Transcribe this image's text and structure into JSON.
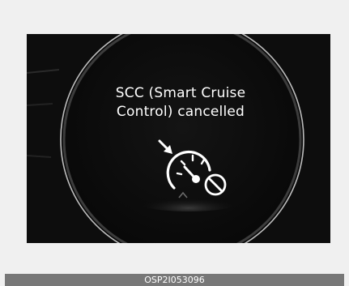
{
  "display": {
    "message_line1": "SCC (Smart Cruise",
    "message_line2": "Control) cancelled",
    "icon": "scc-cancelled-icon"
  },
  "caption": {
    "code": "OSP2I053096"
  },
  "colors": {
    "screen_background": "#0d0d0d",
    "text": "#ffffff",
    "caption_bar": "#777777",
    "frame": "#f0f0f0"
  }
}
